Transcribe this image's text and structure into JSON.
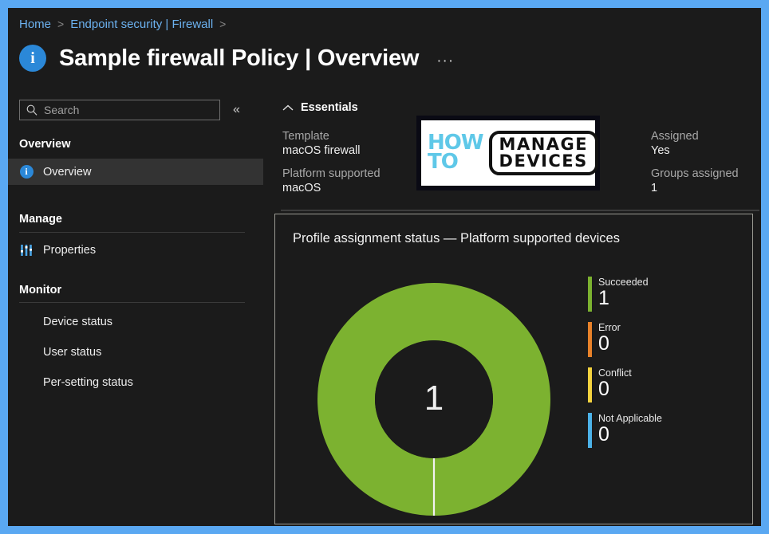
{
  "window": {
    "border_color": "#5aa8f2",
    "background": "#1b1b1b"
  },
  "breadcrumb": {
    "items": [
      {
        "label": "Home"
      },
      {
        "label": "Endpoint security | Firewall"
      }
    ],
    "separator": ">"
  },
  "header": {
    "icon": "info-circle-icon",
    "title": "Sample firewall Policy | Overview",
    "more_label": "···"
  },
  "sidebar": {
    "search": {
      "placeholder": "Search",
      "value": "",
      "icon": "search-icon"
    },
    "collapse_label": "«",
    "groups": [
      {
        "header": "Overview",
        "items": [
          {
            "label": "Overview",
            "icon": "info-circle-icon",
            "selected": true
          }
        ]
      },
      {
        "header": "Manage",
        "items": [
          {
            "label": "Properties",
            "icon": "sliders-icon",
            "selected": false
          }
        ]
      },
      {
        "header": "Monitor",
        "items": [
          {
            "label": "Device status",
            "icon": "",
            "selected": false
          },
          {
            "label": "User status",
            "icon": "",
            "selected": false
          },
          {
            "label": "Per-setting status",
            "icon": "",
            "selected": false
          }
        ]
      }
    ]
  },
  "essentials": {
    "title": "Essentials",
    "chevron": "chevron-up-icon",
    "left_column": [
      {
        "key": "Template",
        "value": "macOS firewall"
      },
      {
        "key": "Platform supported",
        "value": "macOS"
      }
    ],
    "right_column": [
      {
        "key": "Assigned",
        "value": "Yes"
      },
      {
        "key": "Groups assigned",
        "value": "1"
      }
    ]
  },
  "logo": {
    "line1": "HOW",
    "line2": "TO",
    "line3": "MANAGE",
    "line4": "DEVICES",
    "accent_color": "#5fc8e8"
  },
  "chart_data": {
    "type": "pie",
    "title": "Profile assignment status — Platform supported devices",
    "center_value": "1",
    "categories": [
      "Succeeded",
      "Error",
      "Conflict",
      "Not Applicable"
    ],
    "values": [
      1,
      0,
      0,
      0
    ],
    "colors": [
      "#7cb230",
      "#e8822a",
      "#f5d33f",
      "#4cb2e8"
    ],
    "legend_position": "right",
    "total": 1
  }
}
